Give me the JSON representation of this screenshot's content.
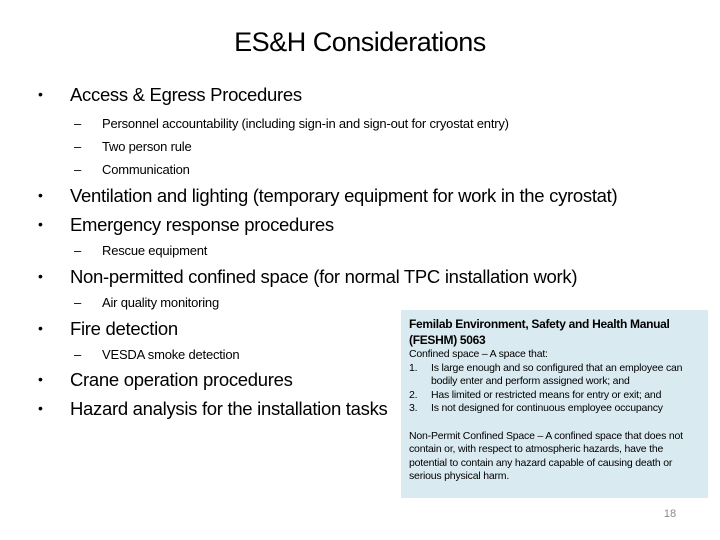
{
  "slide": {
    "title": "ES&H Considerations",
    "page_number": "18"
  },
  "bullets": {
    "b1": {
      "text": "Access & Egress Procedures",
      "subs": [
        "Personnel accountability (including sign-in and sign-out for cryostat entry)",
        "Two person rule",
        "Communication"
      ]
    },
    "b2": {
      "text": "Ventilation and lighting (temporary equipment for work in the cyrostat)"
    },
    "b3": {
      "text": "Emergency response procedures",
      "subs": [
        "Rescue equipment"
      ]
    },
    "b4": {
      "text": "Non-permitted confined space (for normal TPC installation work)",
      "subs": [
        "Air quality monitoring"
      ]
    },
    "b5": {
      "text": "Fire detection",
      "subs": [
        "VESDA smoke detection"
      ]
    },
    "b6": {
      "text": "Crane operation procedures"
    },
    "b7": {
      "text": "Hazard analysis for the installation tasks"
    }
  },
  "symbols": {
    "bullet": "•",
    "dash": "–"
  },
  "callout": {
    "heading": "Femilab Environment, Safety and Health Manual (FESHM) 5063",
    "confined_space_intro": "Confined space – A space that:",
    "criteria": [
      {
        "num": "1.",
        "text": "Is large enough and so configured that an employee can bodily enter and perform assigned work; and"
      },
      {
        "num": "2.",
        "text": "Has limited or restricted means for entry or exit; and"
      },
      {
        "num": "3.",
        "text": "Is not designed for continuous employee occupancy"
      }
    ],
    "non_permit_definition": "Non-Permit Confined Space – A confined space that does not contain or, with respect to atmospheric hazards, have the potential to contain any hazard capable of causing death or serious physical harm.",
    "background_color": "#daeaf1"
  }
}
